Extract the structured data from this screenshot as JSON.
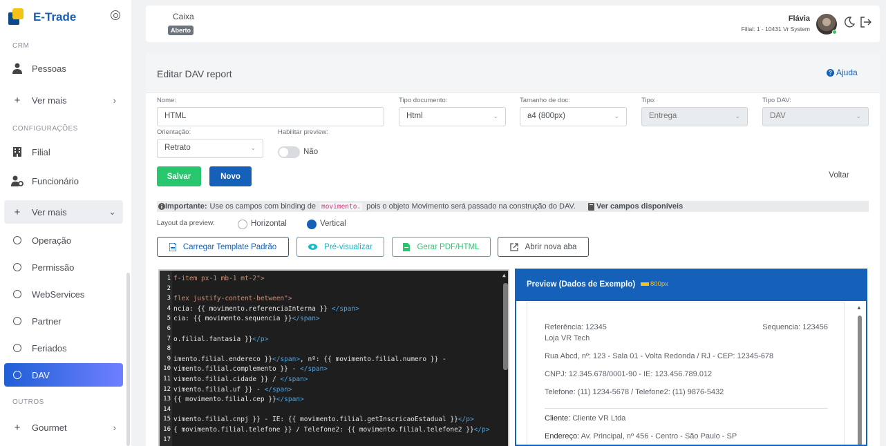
{
  "app": {
    "name": "E-Trade"
  },
  "sidebar": {
    "sections": {
      "crm": "CRM",
      "config": "CONFIGURAÇÕES",
      "outros": "OUTROS"
    },
    "items": [
      {
        "label": "Pessoas",
        "icon": "person-icon"
      },
      {
        "label": "Ver mais",
        "icon": "plus-icon"
      },
      {
        "label": "Filial",
        "icon": "building-icon"
      },
      {
        "label": "Funcionário",
        "icon": "user-gear-icon"
      },
      {
        "label": "Ver mais",
        "icon": "plus-icon"
      },
      {
        "label": "Operação",
        "icon": "circle-icon"
      },
      {
        "label": "Permissão",
        "icon": "circle-icon"
      },
      {
        "label": "WebServices",
        "icon": "circle-icon"
      },
      {
        "label": "Partner",
        "icon": "circle-icon"
      },
      {
        "label": "Feriados",
        "icon": "circle-icon"
      },
      {
        "label": "DAV",
        "icon": "circle-icon"
      },
      {
        "label": "Gourmet",
        "icon": "plus-icon"
      }
    ]
  },
  "header": {
    "caixa_label": "Caixa",
    "caixa_status": "Aberto",
    "user_name": "Flávia",
    "user_branch": "Filial: 1 - 10431 Vr System"
  },
  "page": {
    "title": "Editar DAV report",
    "help": "Ajuda"
  },
  "form": {
    "nome_label": "Nome:",
    "nome_value": "HTML",
    "tipo_documento_label": "Tipo documento:",
    "tipo_documento_value": "Html",
    "tamanho_label": "Tamanho de doc:",
    "tamanho_value": "a4 (800px)",
    "tipo_label": "Tipo:",
    "tipo_value": "Entrega",
    "tipo_dav_label": "Tipo DAV:",
    "tipo_dav_value": "DAV",
    "orientacao_label": "Orientação:",
    "orientacao_value": "Retrato",
    "preview_label": "Habilitar preview:",
    "preview_toggle": "Não"
  },
  "actions": {
    "salvar": "Salvar",
    "novo": "Novo",
    "voltar": "Voltar"
  },
  "info": {
    "prefix": "Importante:",
    "text_a": "Use os campos com binding de",
    "code": "movimento.",
    "text_b": "pois o objeto Movimento será passado na construção do DAV.",
    "link": "Ver campos disponíveis"
  },
  "layout": {
    "label": "Layout da preview:",
    "horizontal": "Horizontal",
    "vertical": "Vertical",
    "selected": "Vertical"
  },
  "tools": {
    "carregar": "Carregar Template Padrão",
    "previsualizar": "Pré-visualizar",
    "gerar": "Gerar PDF/HTML",
    "abrir": "Abrir nova aba"
  },
  "editor": {
    "lines": [
      {
        "n": "1",
        "text": "f-item px-1 mb-1 mt-2\">"
      },
      {
        "n": "2",
        "text": ""
      },
      {
        "n": "3",
        "text": "flex justify-content-between\">"
      },
      {
        "n": "4",
        "text": "ncia: {{ movimento.referenciaInterna }} </span>"
      },
      {
        "n": "5",
        "text": "cia: {{ movimento.sequencia }}</span>"
      },
      {
        "n": "6",
        "text": ""
      },
      {
        "n": "7",
        "text": "o.filial.fantasia }}</p>"
      },
      {
        "n": "8",
        "text": ""
      },
      {
        "n": "9",
        "text": "imento.filial.endereco }}</span>, nº: {{ movimento.filial.numero }} -"
      },
      {
        "n": "10",
        "text": "vimento.filial.complemento }} - </span>"
      },
      {
        "n": "11",
        "text": "vimento.filial.cidade }} / </span>"
      },
      {
        "n": "12",
        "text": "vimento.filial.uf }} - </span>"
      },
      {
        "n": "13",
        "text": "{{ movimento.filial.cep }}</span>"
      },
      {
        "n": "14",
        "text": ""
      },
      {
        "n": "15",
        "text": "vimento.filial.cnpj }} - IE: {{ movimento.filial.getInscricaoEstadual }}</p>"
      },
      {
        "n": "16",
        "text": "{ movimento.filial.telefone }} / Telefone2: {{ movimento.filial.telefone2 }}</p>"
      },
      {
        "n": "17",
        "text": ""
      }
    ]
  },
  "preview": {
    "title": "Preview (Dados de Exemplo)",
    "size": "800px",
    "referencia": "Referência: 12345",
    "sequencia": "Sequencia: 123456",
    "loja": "Loja VR Tech",
    "endereco": "Rua Abcd, nº: 123 - Sala 01 - Volta Redonda / RJ - CEP: 12345-678",
    "cnpj": "CNPJ: 12.345.678/0001-90 - IE: 123.456.789.012",
    "telefone": "Telefone: (11) 1234-5678 / Telefone2: (11) 9876-5432",
    "cliente_label": "Cliente:",
    "cliente_value": "Cliente VR Ltda",
    "endereco_label": "Endereço:",
    "endereco_value": "Av. Principal, nº 456 - Centro - São Paulo - SP"
  },
  "colors": {
    "primary": "#1560b8",
    "success": "#28c76f",
    "teal": "#17b8c8",
    "accent": "#f6c218"
  }
}
